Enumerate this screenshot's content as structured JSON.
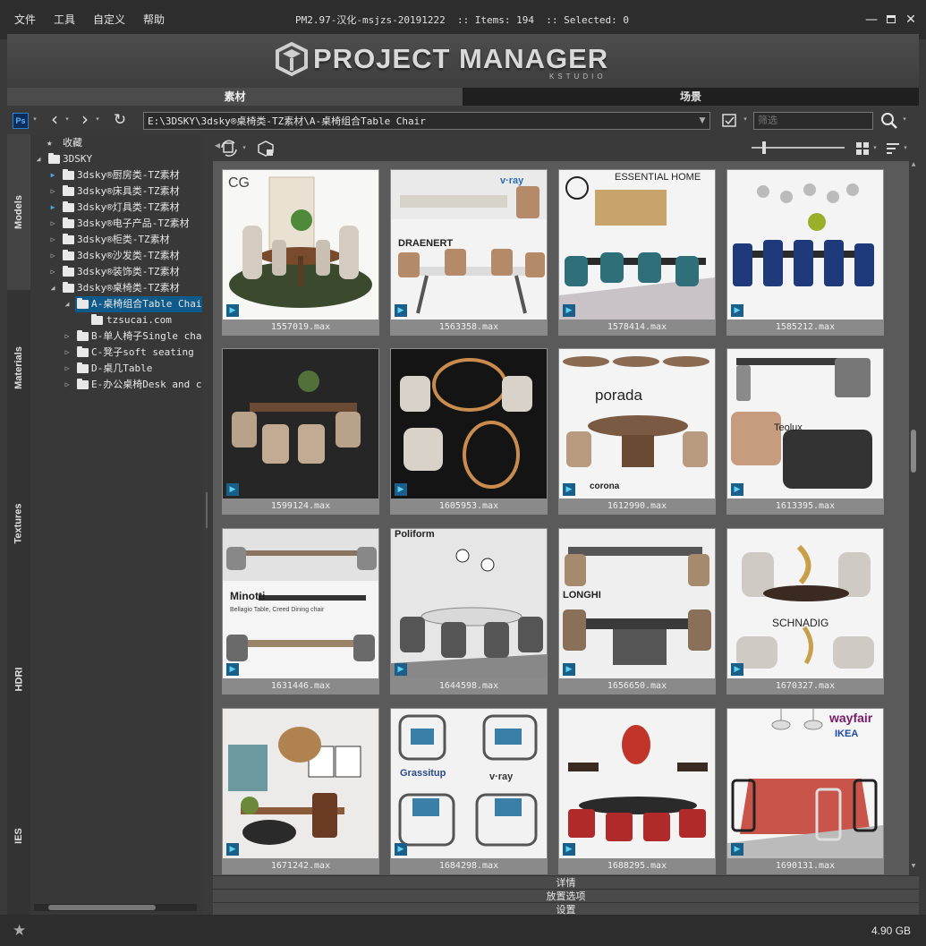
{
  "app": {
    "title": "PM2.97-汉化-msjzs-20191222  :: Items: 194  :: Selected: 0",
    "logo_text": "PROJECT MANAGER",
    "logo_sub": "KSTUDIO"
  },
  "menu": [
    "文件",
    "工具",
    "自定义",
    "帮助"
  ],
  "main_tabs": [
    {
      "label": "素材"
    },
    {
      "label": "场景"
    }
  ],
  "toolbar": {
    "path": "E:\\3DSKY\\3dsky®桌椅类-TZ素材\\A-桌椅组合Table Chair",
    "filter_placeholder": "筛选",
    "ps_label": "Ps"
  },
  "side_tabs": [
    "Models",
    "Materials",
    "Textures",
    "HDRI",
    "IES"
  ],
  "tree": {
    "favorites": "收藏",
    "root": "3DSKY",
    "items": [
      {
        "label": "3dsky®厨房类-TZ素材"
      },
      {
        "label": "3dsky®床具类-TZ素材"
      },
      {
        "label": "3dsky®灯具类-TZ素材"
      },
      {
        "label": "3dsky®电子产品-TZ素材"
      },
      {
        "label": "3dsky®柜类-TZ素材"
      },
      {
        "label": "3dsky®沙发类-TZ素材"
      },
      {
        "label": "3dsky®装饰类-TZ素材"
      },
      {
        "label": "3dsky®桌椅类-TZ素材"
      },
      {
        "label": "A-桌椅组合Table Chair"
      },
      {
        "label": "tzsucai.com"
      },
      {
        "label": "B-单人椅子Single chair"
      },
      {
        "label": "C-凳子soft seating"
      },
      {
        "label": "D-桌几Table"
      },
      {
        "label": "E-办公桌椅Desk and chair"
      }
    ]
  },
  "grid": {
    "badge_text": "▶",
    "items": [
      {
        "label": "1557019.max",
        "brand": "CG"
      },
      {
        "label": "1563358.max",
        "brand": "DRAENERT",
        "brand2": "v·ray"
      },
      {
        "label": "1578414.max",
        "brand": "ESSENTIAL HOME"
      },
      {
        "label": "1585212.max",
        "brand": ""
      },
      {
        "label": "1599124.max",
        "brand": ""
      },
      {
        "label": "1605953.max",
        "brand": ""
      },
      {
        "label": "1612990.max",
        "brand": "porada",
        "brand2": "corona"
      },
      {
        "label": "1613395.max",
        "brand": "Teolux"
      },
      {
        "label": "1631446.max",
        "brand": "Minotti",
        "brand2": "Bellagio Table, Creed Dining chair"
      },
      {
        "label": "1644598.max",
        "brand": "Poliform"
      },
      {
        "label": "1656650.max",
        "brand": "LONGHI"
      },
      {
        "label": "1670327.max",
        "brand": "SCHNADIG"
      },
      {
        "label": "1671242.max",
        "brand": ""
      },
      {
        "label": "1684298.max",
        "brand": "Grassitup",
        "brand2": "v·ray"
      },
      {
        "label": "1688295.max",
        "brand": ""
      },
      {
        "label": "1690131.max",
        "brand": "wayfair",
        "brand2": "IKEA"
      }
    ]
  },
  "panels": [
    "详情",
    "放置选项",
    "设置"
  ],
  "status": {
    "size": "4.90 GB"
  },
  "colors": {
    "titlebar": "#2d2d2d",
    "tab_active": "#4b4b4b",
    "tab_inactive": "#1f1f1f",
    "selection": "#0e5a8a",
    "max_badge": "#1a5f8a"
  }
}
